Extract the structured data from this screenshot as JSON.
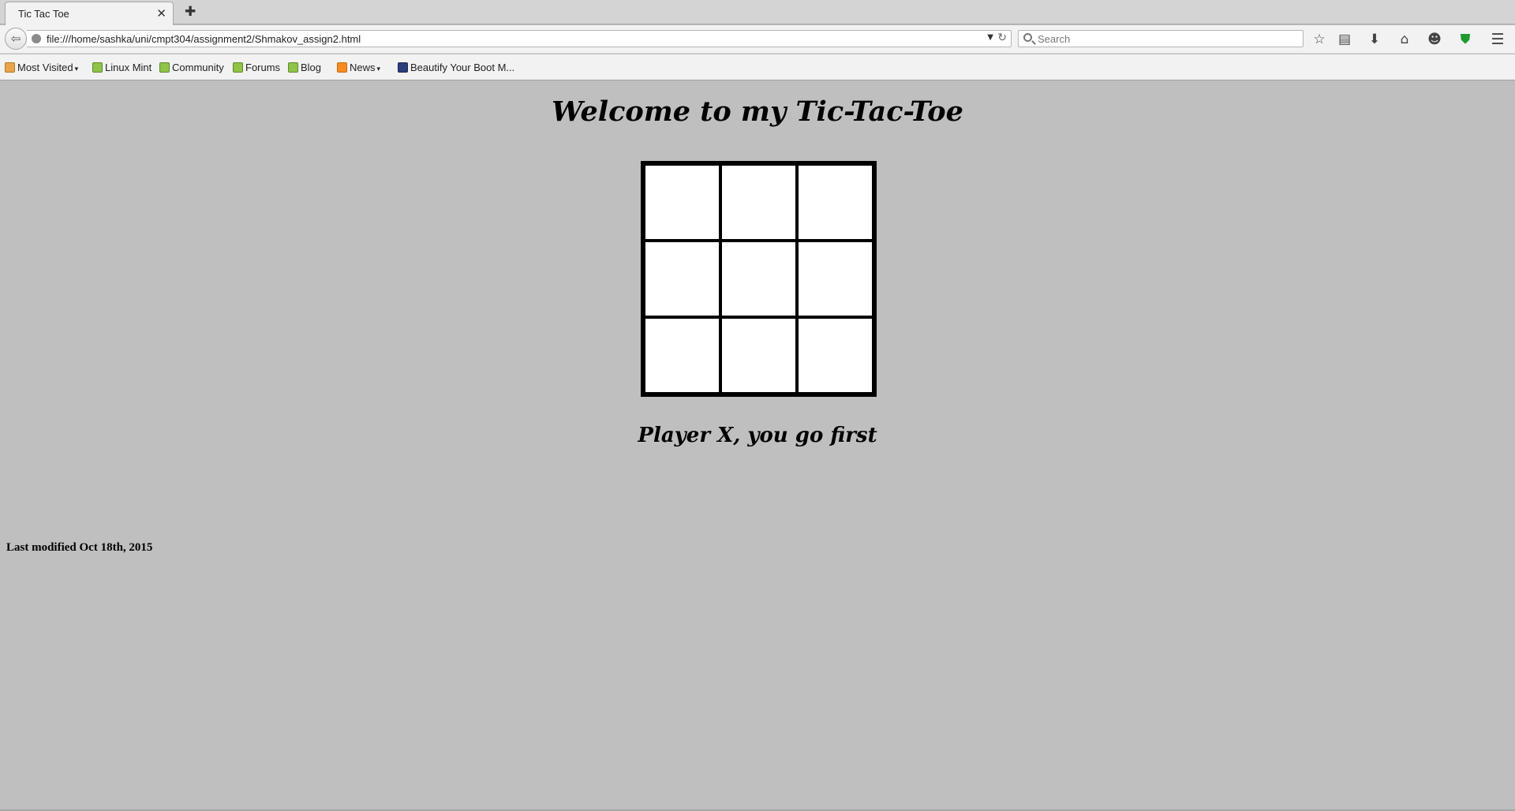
{
  "tab": {
    "title": "Tic Tac Toe",
    "close_glyph": "✕",
    "new_tab_glyph": "✚"
  },
  "navbar": {
    "back_glyph": "⇦",
    "url": "file:///home/sashka/uni/cmpt304/assignment2/Shmakov_assign2.html",
    "url_dropdown_glyph": "▼",
    "reload_glyph": "↻",
    "search_placeholder": "Search",
    "icons": {
      "bookmark_star": "☆",
      "reading_list": "▤",
      "download": "⬇",
      "home": "⌂",
      "chat": "☻",
      "shield": "⛊",
      "menu": "☰"
    }
  },
  "bookmarks": [
    {
      "label": "Most Visited",
      "icon": "folder",
      "has_dropdown": true
    },
    {
      "label": "Linux Mint",
      "icon": "mint"
    },
    {
      "label": "Community",
      "icon": "mint"
    },
    {
      "label": "Forums",
      "icon": "mint"
    },
    {
      "label": "Blog",
      "icon": "mint"
    },
    {
      "label": "News",
      "icon": "rss",
      "has_dropdown": true
    },
    {
      "label": "Beautify Your Boot M...",
      "icon": "hb"
    }
  ],
  "caret_glyph": "▾",
  "game": {
    "title": "Welcome to my Tic-Tac-Toe",
    "board": [
      "",
      "",
      "",
      "",
      "",
      "",
      "",
      "",
      ""
    ],
    "status": "Player X, you go first"
  },
  "footer": {
    "text": "Last modified Oct 18th, 2015"
  }
}
